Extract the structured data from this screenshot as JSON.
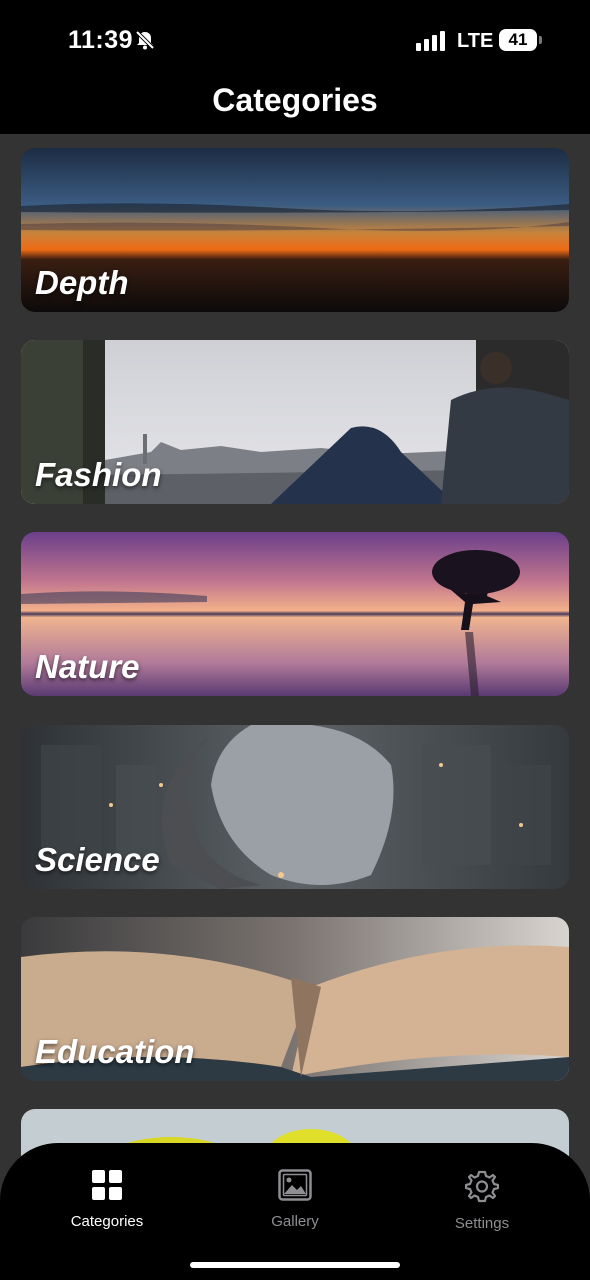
{
  "status_bar": {
    "time": "11:39",
    "network": "LTE",
    "battery": "41"
  },
  "header": {
    "title": "Categories"
  },
  "categories": [
    {
      "label": "Depth"
    },
    {
      "label": "Fashion"
    },
    {
      "label": "Nature"
    },
    {
      "label": "Science"
    },
    {
      "label": "Education"
    }
  ],
  "tabbar": {
    "tabs": [
      {
        "label": "Categories",
        "icon": "grid-icon",
        "active": true
      },
      {
        "label": "Gallery",
        "icon": "image-icon",
        "active": false
      },
      {
        "label": "Settings",
        "icon": "gear-icon",
        "active": false
      }
    ]
  },
  "colors": {
    "background": "#333333",
    "bar": "#000000",
    "inactive_tab": "#8e8e93",
    "active_tab": "#ffffff"
  }
}
